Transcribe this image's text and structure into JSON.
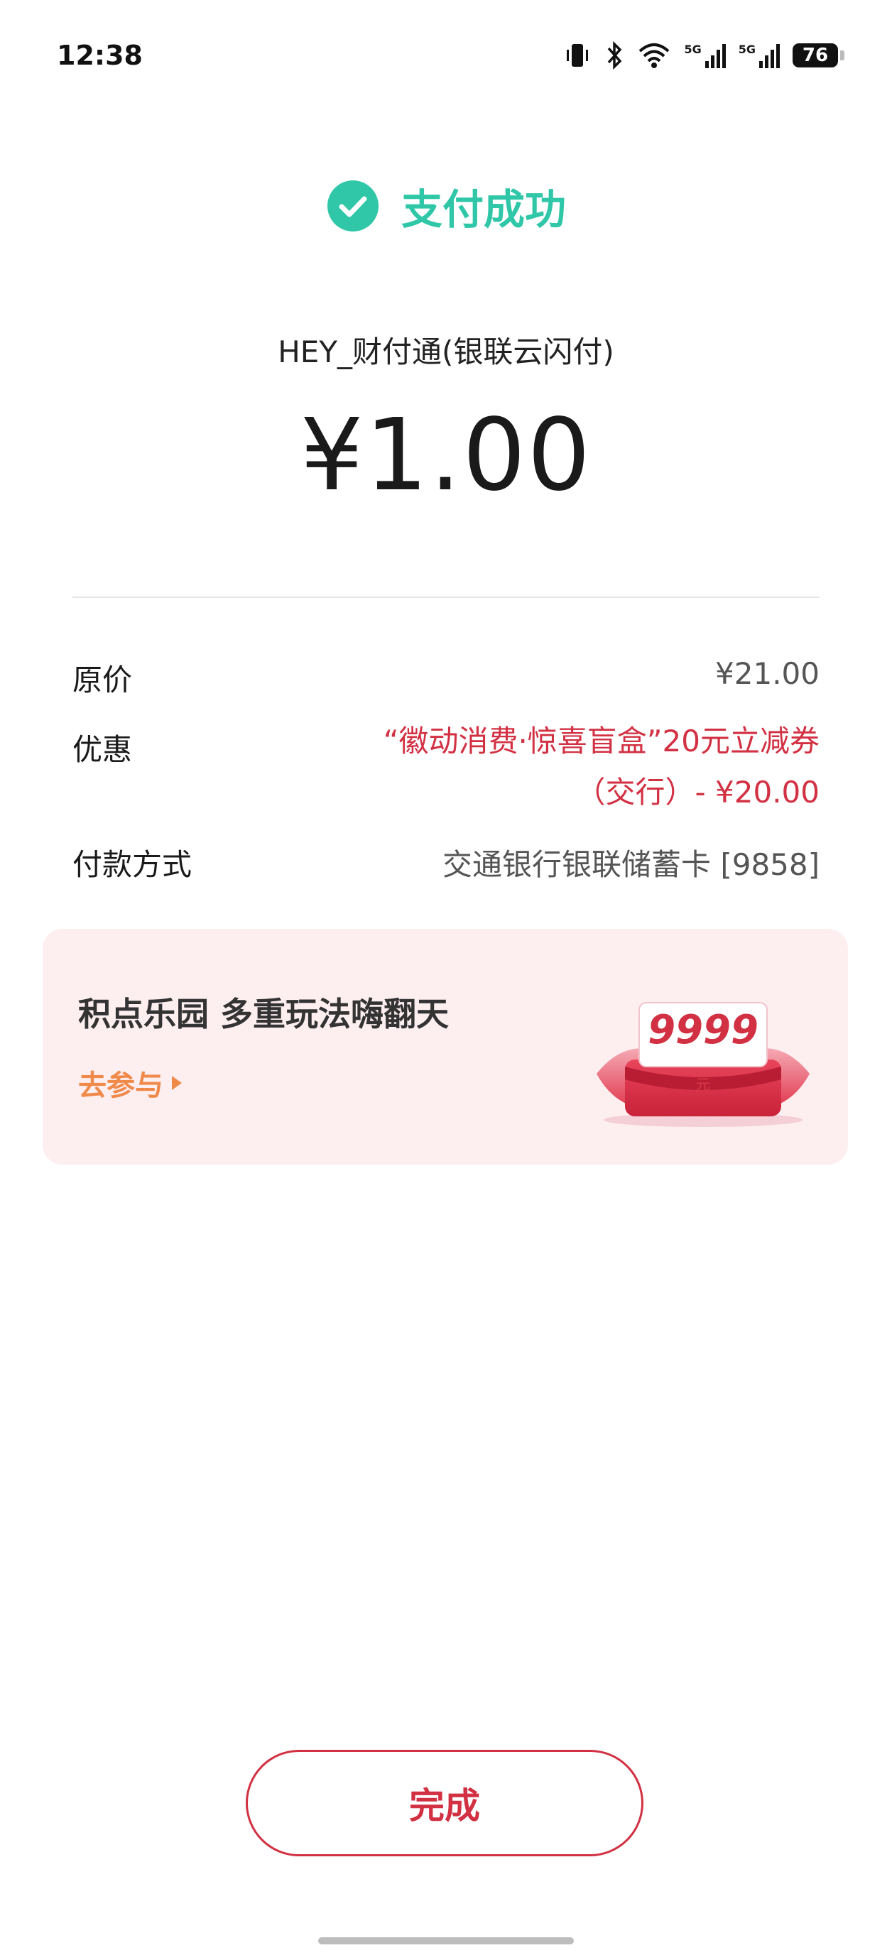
{
  "status_bar": {
    "time": "12:38",
    "battery": "76"
  },
  "success": {
    "text": "支付成功"
  },
  "merchant": "HEY_财付通(银联云闪付)",
  "amount": "¥1.00",
  "details": {
    "original_label": "原价",
    "original_value": "¥21.00",
    "discount_label": "优惠",
    "discount_line1": "“徽动消费·惊喜盲盒”20元立减券",
    "discount_line2": "（交行）- ¥20.00",
    "payment_label": "付款方式",
    "payment_value": "交通银行银联储蓄卡 [9858]"
  },
  "promo": {
    "title": "积点乐园 多重玩法嗨翻天",
    "link": "去参与",
    "badge_number": "9999",
    "badge_unit": "元"
  },
  "done_button": "完成",
  "colors": {
    "accent_red": "#d23143",
    "success_green": "#2fc7a8",
    "promo_bg": "#fdeef0",
    "link_orange": "#f08a4b"
  }
}
